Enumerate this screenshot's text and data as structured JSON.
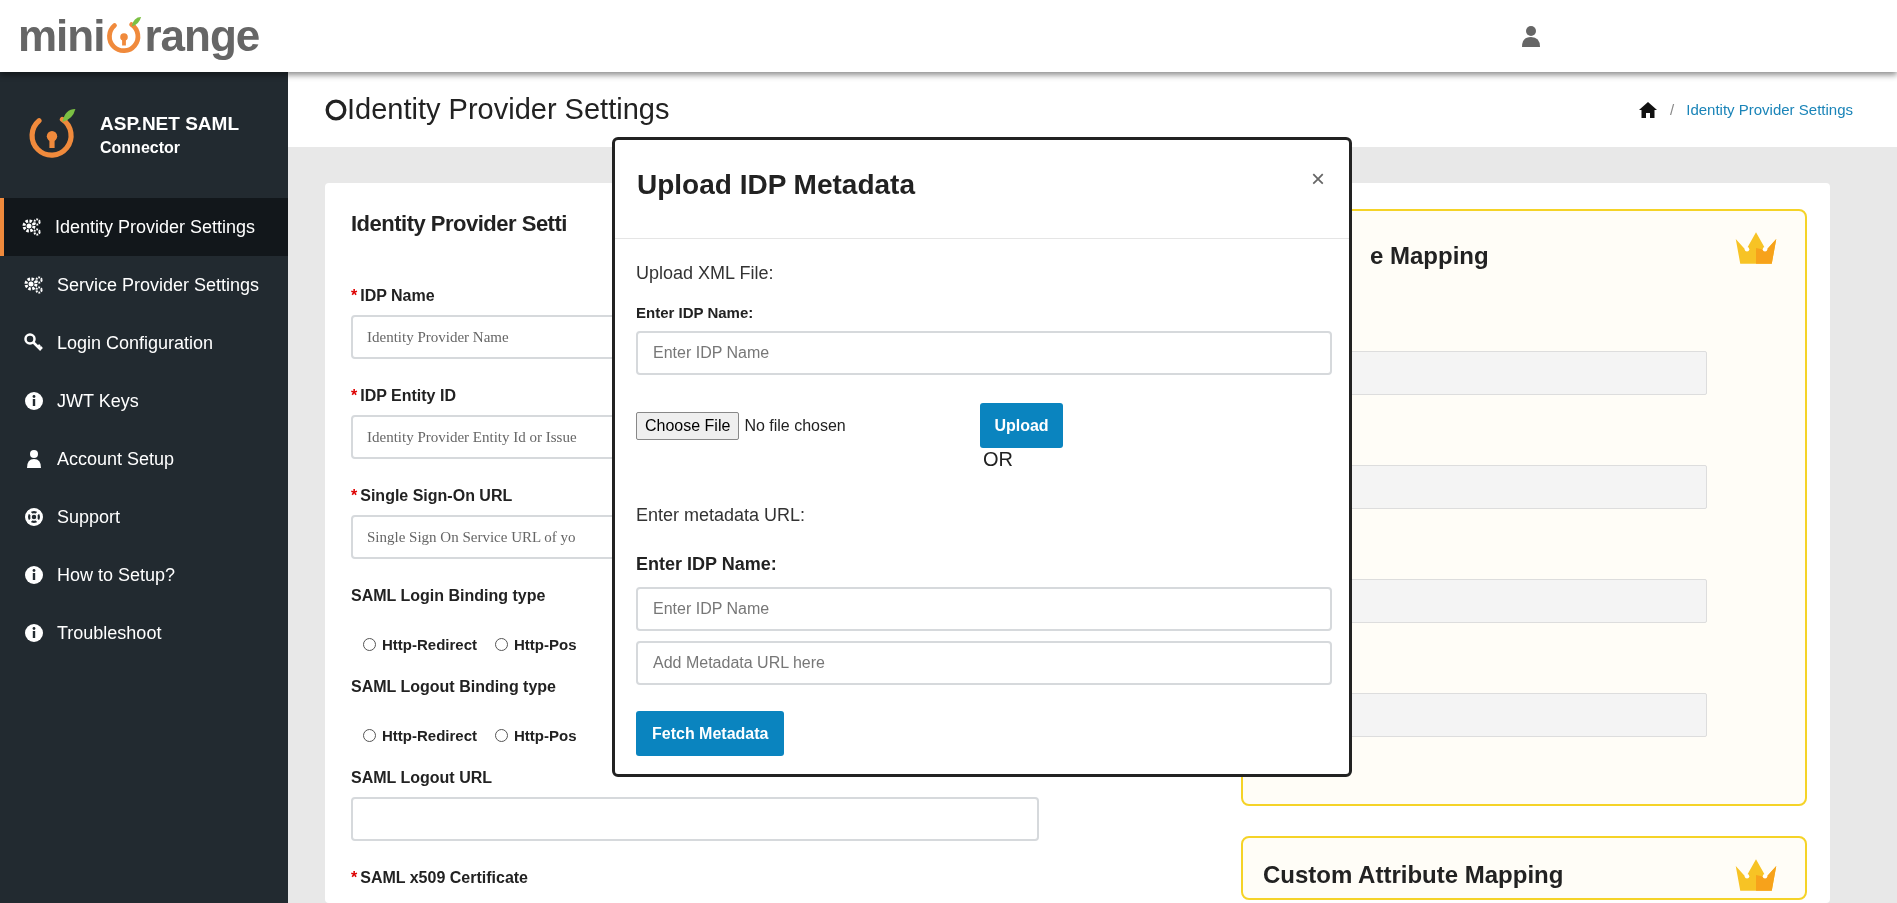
{
  "header": {
    "logo": {
      "left": "mini",
      "right": "range"
    }
  },
  "sidebar": {
    "brand": {
      "title": "ASP.NET SAML",
      "subtitle": "Connector"
    },
    "items": [
      {
        "label": "Identity Provider Settings",
        "selected": true
      },
      {
        "label": "Service Provider Settings",
        "selected": false
      },
      {
        "label": "Login Configuration",
        "selected": false
      },
      {
        "label": "JWT Keys",
        "selected": false
      },
      {
        "label": "Account Setup",
        "selected": false
      },
      {
        "label": "Support",
        "selected": false
      },
      {
        "label": "How to Setup?",
        "selected": false
      },
      {
        "label": "Troubleshoot",
        "selected": false
      }
    ]
  },
  "page": {
    "title": "Identity Provider Settings",
    "breadcrumb": {
      "separator": "/",
      "current": "Identity Provider Settings"
    }
  },
  "form": {
    "title": "Identity Provider Setti",
    "fields": [
      {
        "kind": "text",
        "required_mark": "*",
        "label": "IDP Name",
        "placeholder": "Identity Provider Name"
      },
      {
        "kind": "text",
        "required_mark": "*",
        "label": "IDP Entity ID",
        "placeholder": "Identity Provider Entity Id or Issue"
      },
      {
        "kind": "text",
        "required_mark": "*",
        "label": "Single Sign-On URL",
        "placeholder": "Single Sign On Service URL of yo"
      },
      {
        "kind": "radio",
        "label": "SAML Login Binding type",
        "options": [
          {
            "label": "Http-Redirect",
            "checked": false
          },
          {
            "label": "Http-Pos",
            "checked": false
          }
        ]
      },
      {
        "kind": "radio",
        "label": "SAML Logout Binding type",
        "options": [
          {
            "label": "Http-Redirect",
            "checked": false
          },
          {
            "label": "Http-Pos",
            "checked": false
          }
        ]
      },
      {
        "kind": "wide",
        "label": "SAML Logout URL"
      },
      {
        "kind": "label",
        "required_mark": "*",
        "label": "SAML x509 Certificate"
      }
    ]
  },
  "premium_cards": [
    {
      "title": "e Mapping",
      "inputs": [
        {
          "disabled": true
        },
        {
          "disabled": true
        },
        {
          "disabled": true
        },
        {
          "disabled": true
        }
      ]
    },
    {
      "title": "Custom Attribute Mapping"
    }
  ],
  "modal": {
    "title": "Upload IDP Metadata",
    "close": "×",
    "xml_section": {
      "heading": "Upload XML File:",
      "label": "Enter IDP Name:",
      "placeholder": "Enter IDP Name",
      "file_button": "Choose File",
      "file_status": "No file chosen",
      "upload_button": "Upload"
    },
    "separator": "OR",
    "url_section": {
      "heading": "Enter metadata URL:",
      "label": "Enter IDP Name:",
      "name_placeholder": "Enter IDP Name",
      "url_placeholder": "Add Metadata URL here",
      "fetch_button": "Fetch Metadata"
    }
  }
}
